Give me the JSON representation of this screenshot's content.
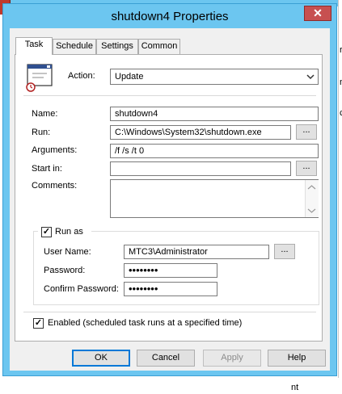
{
  "background": {
    "bottom_right_fragment": "nt",
    "right_edge_fragments": [
      "r",
      "n",
      "c"
    ]
  },
  "window": {
    "title": "shutdown4 Properties",
    "close_glyph": "✕"
  },
  "tabs": [
    {
      "label": "Task",
      "active": true
    },
    {
      "label": "Schedule",
      "active": false
    },
    {
      "label": "Settings",
      "active": false
    },
    {
      "label": "Common",
      "active": false
    }
  ],
  "task": {
    "action_label": "Action:",
    "action_value": "Update",
    "name_label": "Name:",
    "name_value": "shutdown4",
    "run_label": "Run:",
    "run_value": "C:\\Windows\\System32\\shutdown.exe",
    "arguments_label": "Arguments:",
    "arguments_value": "/f /s /t 0",
    "start_in_label": "Start in:",
    "start_in_value": "",
    "comments_label": "Comments:",
    "comments_value": "",
    "browse_label": "...",
    "run_as": {
      "label": "Run as",
      "checked": true,
      "user_label": "User Name:",
      "user_value": "MTC3\\Administrator",
      "password_label": "Password:",
      "password_value": "••••••••",
      "confirm_label": "Confirm Password:",
      "confirm_value": "••••••••"
    },
    "enabled_label": "Enabled (scheduled task runs at a specified time)",
    "enabled_checked": true
  },
  "buttons": {
    "ok": "OK",
    "cancel": "Cancel",
    "apply": "Apply",
    "help": "Help"
  },
  "icons": {
    "task_icon": "scheduled-task-icon",
    "dropdown": "chevron-down-icon",
    "scroll_up": "scroll-up-icon",
    "scroll_down": "scroll-down-icon",
    "checkmark": "✓"
  },
  "colors": {
    "title_bar": "#6cc6f0",
    "close_button": "#c75050",
    "default_button_border": "#0078d7"
  }
}
